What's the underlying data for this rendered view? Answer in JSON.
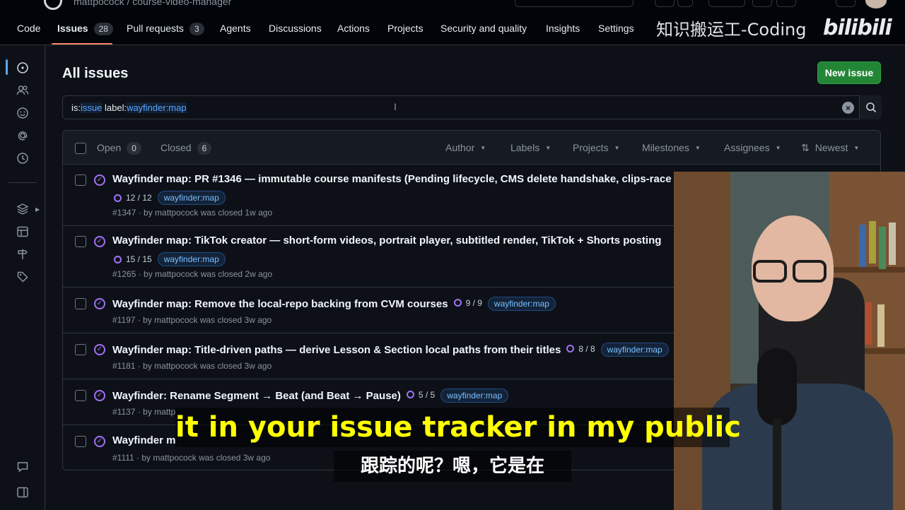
{
  "topbar": {
    "breadcrumb": "mattpocock / course-video-manager"
  },
  "repo_nav": {
    "items": [
      {
        "label": "Code",
        "count": null
      },
      {
        "label": "Issues",
        "count": "28",
        "active": true
      },
      {
        "label": "Pull requests",
        "count": "3"
      },
      {
        "label": "Agents",
        "count": null
      },
      {
        "label": "Discussions",
        "count": null
      },
      {
        "label": "Actions",
        "count": null
      },
      {
        "label": "Projects",
        "count": null
      },
      {
        "label": "Security and quality",
        "count": null
      },
      {
        "label": "Insights",
        "count": null
      },
      {
        "label": "Settings",
        "count": null
      }
    ]
  },
  "watermark": {
    "text": "知识搬运工-Coding",
    "brand": "bilibili"
  },
  "page": {
    "title": "All issues",
    "new_issue_label": "New issue"
  },
  "search": {
    "prefix1": "is:",
    "value1": "issue",
    "prefix2": "label:",
    "value2": "wayfinder:map"
  },
  "list_header": {
    "open_label": "Open",
    "open_count": "0",
    "closed_label": "Closed",
    "closed_count": "6",
    "filters": [
      "Author",
      "Labels",
      "Projects",
      "Milestones",
      "Assignees"
    ],
    "sort_label": "Newest"
  },
  "issues": [
    {
      "title": "Wayfinder map: PR #1346 — immutable course manifests (Pending lifecycle, CMS delete handshake, clips-race",
      "progress": "12 / 12",
      "label": "wayfinder:map",
      "meta": "#1347 · by mattpocock was closed 1w ago"
    },
    {
      "title": "Wayfinder map: TikTok creator — short-form videos, portrait player, subtitled render, TikTok + Shorts posting",
      "progress": "15 / 15",
      "label": "wayfinder:map",
      "meta": "#1265 · by mattpocock was closed 2w ago"
    },
    {
      "title": "Wayfinder map: Remove the local-repo backing from CVM courses",
      "progress": "9 / 9",
      "label": "wayfinder:map",
      "meta": "#1197 · by mattpocock was closed 3w ago"
    },
    {
      "title": "Wayfinder map: Title-driven paths — derive Lesson & Section local paths from their titles",
      "progress": "8 / 8",
      "label": "wayfinder:map",
      "meta": "#1181 · by mattpocock was closed 3w ago"
    },
    {
      "title": "Wayfinder: Rename Segment → Beat (and Beat → Pause)",
      "progress": "5 / 5",
      "label": "wayfinder:map",
      "meta": "#1137 · by mattp"
    },
    {
      "title": "Wayfinder m",
      "progress": "",
      "label": "",
      "meta": "#1111 · by mattpocock was closed 3w ago"
    }
  ],
  "subtitles": {
    "english": "it in your issue tracker in my public",
    "chinese": "跟踪的呢？嗯，它是在"
  },
  "colors": {
    "accent_green": "#238636",
    "closed_purple": "#a371f7",
    "label_blue": "#79c0ff",
    "subtitle_yellow": "#ffff00"
  },
  "icons": {
    "rail": [
      "issue-circle-icon",
      "people-icon",
      "smiley-icon",
      "mention-icon",
      "clock-icon",
      "stack-icon",
      "table-icon",
      "signpost-icon",
      "tag-icon",
      "comment-icon",
      "sidebar-icon"
    ]
  }
}
